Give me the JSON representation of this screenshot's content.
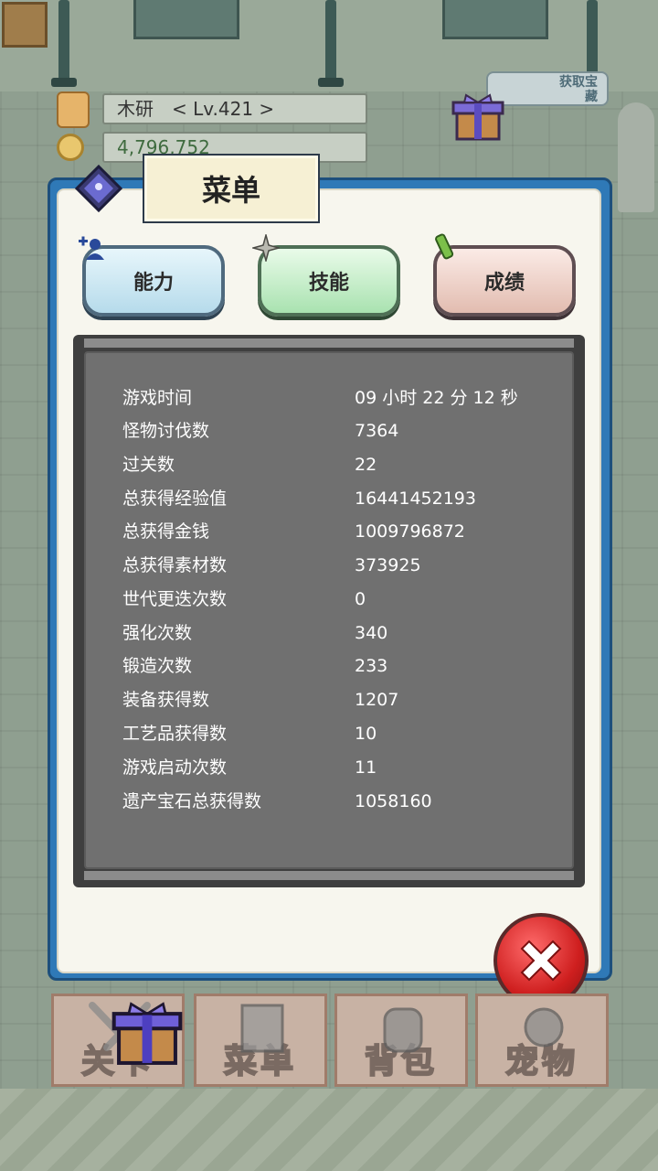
{
  "player": {
    "name_level": "木研　< Lv.421 >",
    "gold": "4,796,752"
  },
  "get_gem_button": {
    "label": "获取宝藏"
  },
  "dialog": {
    "title": "菜单",
    "tabs": [
      {
        "label": "能力",
        "icon": "add-person-icon"
      },
      {
        "label": "技能",
        "icon": "shuriken-icon"
      },
      {
        "label": "成绩",
        "icon": "scroll-icon"
      }
    ],
    "stats": [
      {
        "label": "游戏时间",
        "value": "09 小时 22 分 12 秒"
      },
      {
        "label": "怪物讨伐数",
        "value": "7364"
      },
      {
        "label": "过关数",
        "value": "22"
      },
      {
        "label": "总获得经验值",
        "value": "16441452193"
      },
      {
        "label": "总获得金钱",
        "value": "1009796872"
      },
      {
        "label": "总获得素材数",
        "value": "373925"
      },
      {
        "label": "世代更迭次数",
        "value": "0"
      },
      {
        "label": "强化次数",
        "value": "340"
      },
      {
        "label": "锻造次数",
        "value": "233"
      },
      {
        "label": "装备获得数",
        "value": "1207"
      },
      {
        "label": "工艺品获得数",
        "value": "10"
      },
      {
        "label": "游戏启动次数",
        "value": "11"
      },
      {
        "label": "遗产宝石总获得数",
        "value": "1058160"
      }
    ]
  },
  "bottom_menu": [
    {
      "label": "关卡",
      "icon": "swords-icon"
    },
    {
      "label": "菜单",
      "icon": "book-icon"
    },
    {
      "label": "背包",
      "icon": "backpack-icon"
    },
    {
      "label": "宠物",
      "icon": "pet-skull-icon"
    }
  ],
  "colors": {
    "dialog_border": "#2f79b7",
    "panel_bg": "#707070",
    "close_button": "#cf1f1f"
  }
}
